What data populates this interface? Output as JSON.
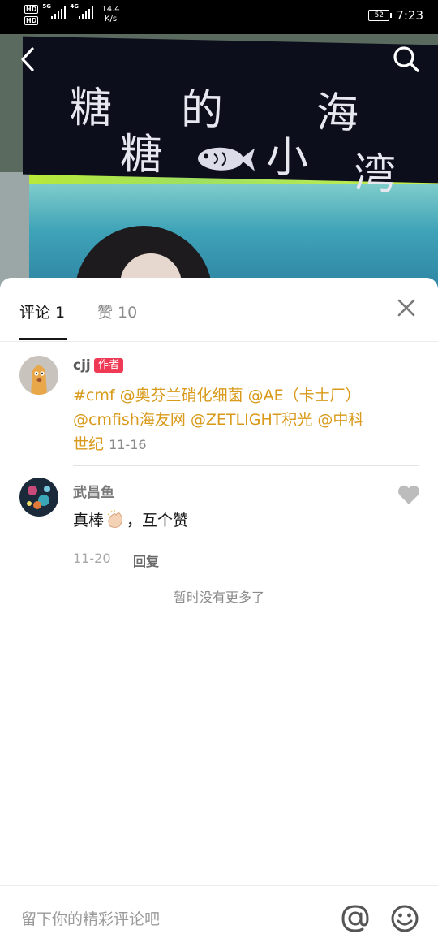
{
  "status_bar": {
    "sim1": "HD",
    "sim2": "HD",
    "net1": "5G",
    "net2": "4G",
    "speed_value": "14.4",
    "speed_unit": "K/s",
    "battery": "52",
    "time": "7:23"
  },
  "video": {
    "banner_chars": [
      "糖",
      "的",
      "海",
      "糖",
      "小",
      "湾"
    ]
  },
  "tabs": {
    "comments": "评论 1",
    "likes": "赞 10"
  },
  "comments": [
    {
      "user": "cjj",
      "badge": "作者",
      "text": "#cmf @奥芬兰硝化细菌 @AE（卡士厂） @cmfish海友网 @ZETLIGHT积光 @中科世纪",
      "time": "11-16"
    },
    {
      "user": "武昌鱼",
      "text_before": "真棒",
      "text_after": "，互个赞",
      "time": "11-20",
      "reply_label": "回复"
    }
  ],
  "no_more": "暂时没有更多了",
  "input": {
    "placeholder": "留下你的精彩评论吧"
  },
  "colors": {
    "mention": "#d99a1b",
    "badge": "#f03a55"
  },
  "icons": [
    "back-arrow-icon",
    "search-icon",
    "close-icon",
    "heart-icon",
    "at-icon",
    "emoji-icon",
    "clap-emoji-icon",
    "fish-icon"
  ]
}
